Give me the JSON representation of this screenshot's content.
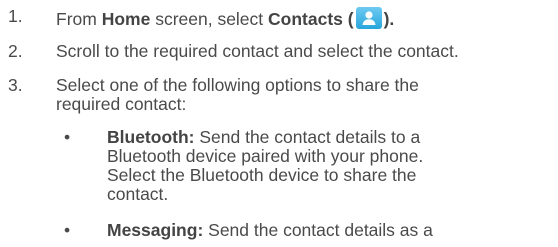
{
  "steps": [
    {
      "number": "1.",
      "parts": [
        "From ",
        "Home",
        " screen, select ",
        "Contacts (",
        ")."
      ]
    },
    {
      "number": "2.",
      "text": "Scroll to the required contact and select the contact."
    },
    {
      "number": "3.",
      "text": "Select one of the following options to share the\nrequired contact:"
    }
  ],
  "options": [
    {
      "bullet": "•",
      "label": "Bluetooth:",
      "text": " Send the contact details to a\nBluetooth device paired with your phone.\nSelect the Bluetooth device to share the\ncontact."
    },
    {
      "bullet": "•",
      "label": "Messaging:",
      "text": " Send the contact details as a"
    }
  ],
  "icons": {
    "contacts": "contacts-person-icon"
  },
  "colors": {
    "icon_top": "#6ecaf1",
    "icon_bottom": "#28a6dc",
    "text": "#4a4a4a"
  }
}
